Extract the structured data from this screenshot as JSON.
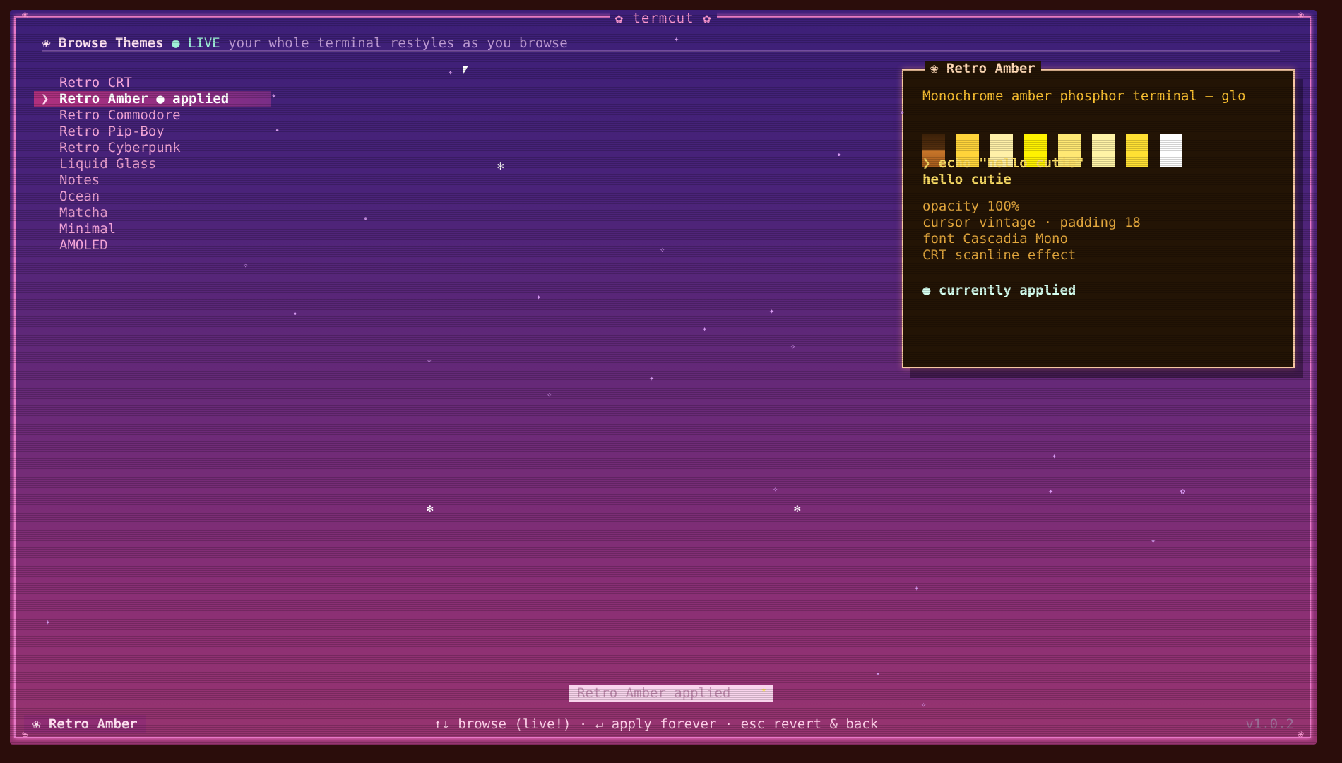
{
  "app": {
    "title": "termcut"
  },
  "header": {
    "flower_icon": "❀",
    "title": "Browse Themes",
    "live_dot": "●",
    "live_label": "LIVE",
    "subtitle": "your whole terminal restyles as you browse"
  },
  "themes": [
    {
      "label": "Retro CRT",
      "selected": false
    },
    {
      "label": "Retro Amber ● applied",
      "selected": true
    },
    {
      "label": "Retro Commodore",
      "selected": false
    },
    {
      "label": "Retro Pip-Boy",
      "selected": false
    },
    {
      "label": "Retro Cyberpunk",
      "selected": false
    },
    {
      "label": "Liquid Glass",
      "selected": false
    },
    {
      "label": "Notes",
      "selected": false
    },
    {
      "label": "Ocean",
      "selected": false
    },
    {
      "label": "Matcha",
      "selected": false
    },
    {
      "label": "Minimal",
      "selected": false
    },
    {
      "label": "AMOLED",
      "selected": false
    }
  ],
  "preview": {
    "title": "Retro Amber",
    "description": "Monochrome amber phosphor terminal — glo",
    "swatches": [
      "#4a2a10",
      "#ffd43a",
      "#fff0a8",
      "#fff200",
      "#ffe873",
      "#fff3a6",
      "#ffe033",
      "#ffffff"
    ],
    "command": "❯ echo \"hello cutie\"",
    "output": "hello cutie",
    "opacity": "opacity 100%",
    "cursor": "cursor vintage · padding 18",
    "font": "font Cascadia Mono",
    "effect": "CRT scanline effect",
    "status": "● currently applied"
  },
  "toast": {
    "text": "Retro Amber applied",
    "star": "★"
  },
  "statusbar": {
    "theme": "❀ Retro Amber",
    "keys": "↑↓ browse (live!) · ↵ apply forever · esc revert & back",
    "version": "v1.0.2"
  },
  "colors": {
    "accent": "#e67ac7",
    "amber": "#ffc432",
    "selection": "#b1307e"
  }
}
